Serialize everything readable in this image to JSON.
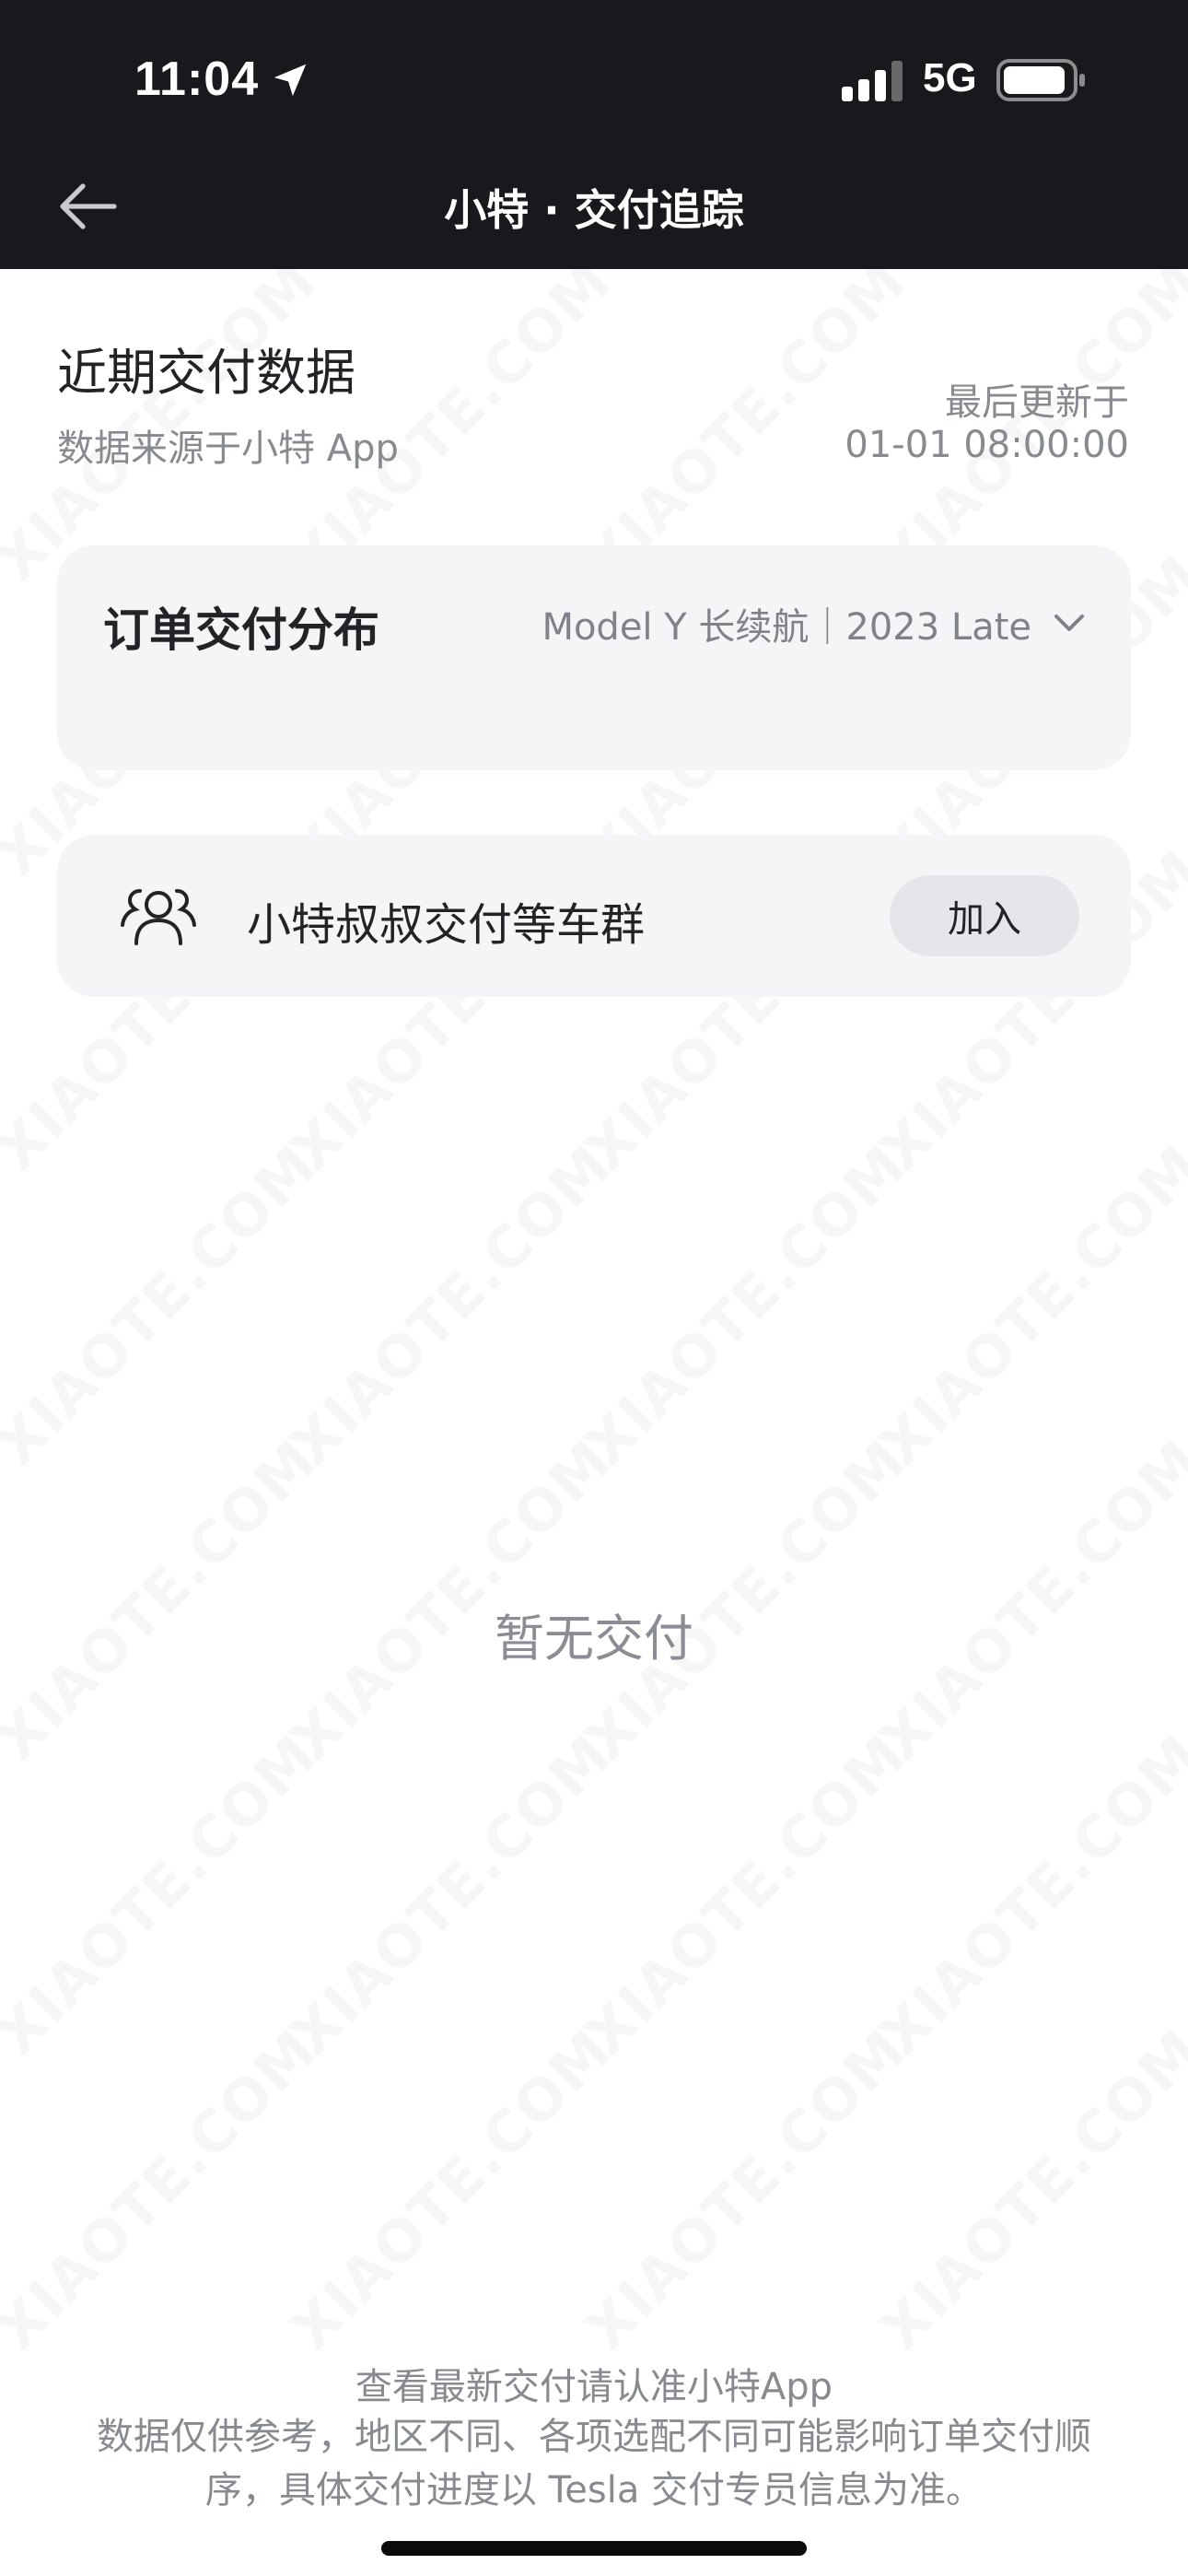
{
  "status_bar": {
    "time": "11:04",
    "network": "5G"
  },
  "nav": {
    "title": "小特 · 交付追踪"
  },
  "recent": {
    "title": "近期交付数据",
    "source": "数据来源于小特 App",
    "updated_label": "最后更新于",
    "updated_time": "01-01 08:00:00"
  },
  "distribution": {
    "title": "订单交付分布",
    "selected_model": "Model Y 长续航｜2023 Late"
  },
  "group": {
    "label": "小特叔叔交付等车群",
    "join_label": "加入"
  },
  "empty_state": "暂无交付",
  "footer": {
    "line1": "查看最新交付请认准小特App",
    "line2": "数据仅供参考，地区不同、各项选配不同可能影响订单交付顺序，具体交付进度以 Tesla 交付专员信息为准。"
  },
  "watermark": "XIAOTE.COM",
  "colors": {
    "header_bg": "#18191d",
    "card_bg": "#f4f5f7",
    "muted_text": "#878a8f",
    "primary_text": "#222326"
  }
}
